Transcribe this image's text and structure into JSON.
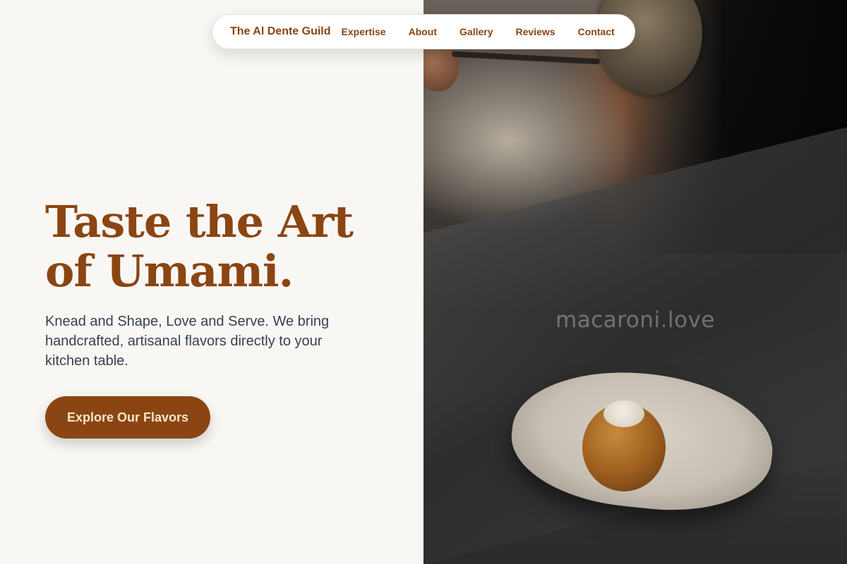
{
  "nav": {
    "brand": "The Al Dente Guild",
    "links": [
      "Expertise",
      "About",
      "Gallery",
      "Reviews",
      "Contact"
    ]
  },
  "hero": {
    "title_line1": "Taste the Art",
    "title_line2": "of Umami.",
    "description": "Knead and Shape, Love and Serve. We bring handcrafted, artisanal flavors directly to your kitchen table.",
    "cta_label": "Explore Our Flavors"
  },
  "photo": {
    "watermark": "macaroni.love"
  },
  "colors": {
    "accent": "#8b4513",
    "background": "#f9f7f4",
    "body_text": "#374151",
    "cta_text": "#f5e6c8"
  }
}
